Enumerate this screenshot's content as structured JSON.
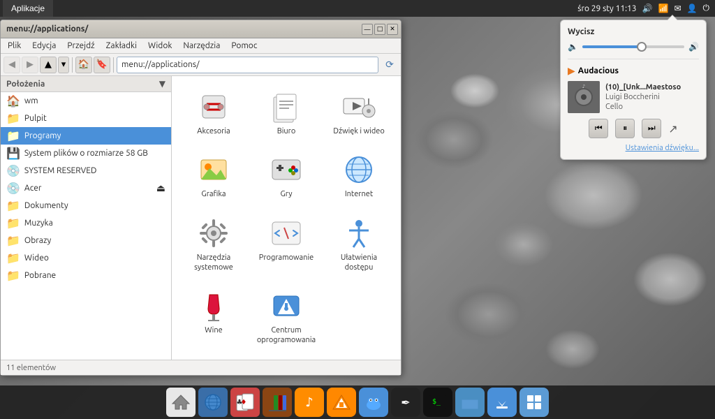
{
  "desktop": {
    "background_description": "rocky stones"
  },
  "top_panel": {
    "apps_button": "Aplikacje",
    "datetime": "śro 29 sty 11:13",
    "icons": [
      "volume",
      "wifi",
      "email",
      "user",
      "power"
    ]
  },
  "file_manager": {
    "title": "menu://applications/",
    "window_buttons": {
      "minimize": "—",
      "maximize": "□",
      "close": "✕"
    },
    "menubar": [
      {
        "label": "Plik"
      },
      {
        "label": "Edycja"
      },
      {
        "label": "Przejdź"
      },
      {
        "label": "Zakładki"
      },
      {
        "label": "Widok"
      },
      {
        "label": "Narzędzia"
      },
      {
        "label": "Pomoc"
      }
    ],
    "toolbar": {
      "back_disabled": true,
      "forward_disabled": true,
      "up_enabled": true,
      "down_arrow": true,
      "home_enabled": true,
      "bookmark_enabled": true,
      "address": "menu://applications/",
      "reload_label": "⟳"
    },
    "sidebar": {
      "header": "Położenia",
      "items": [
        {
          "label": "wm",
          "icon": "🏠",
          "type": "home"
        },
        {
          "label": "Pulpit",
          "icon": "📁",
          "type": "folder"
        },
        {
          "label": "Programy",
          "icon": "📁",
          "type": "folder",
          "active": true
        },
        {
          "label": "System plików o rozmiarze 58 GB",
          "icon": "💾",
          "type": "drive"
        },
        {
          "label": "SYSTEM RESERVED",
          "icon": "💿",
          "type": "drive"
        },
        {
          "label": "Acer",
          "icon": "💿",
          "type": "drive-eject"
        },
        {
          "label": "Dokumenty",
          "icon": "📁",
          "type": "folder"
        },
        {
          "label": "Muzyka",
          "icon": "📁",
          "type": "folder"
        },
        {
          "label": "Obrazy",
          "icon": "📁",
          "type": "folder"
        },
        {
          "label": "Wideo",
          "icon": "📁",
          "type": "folder"
        },
        {
          "label": "Pobrane",
          "icon": "📁",
          "type": "folder"
        }
      ]
    },
    "files": [
      {
        "label": "Akcesoria",
        "icon": "scissors"
      },
      {
        "label": "Biuro",
        "icon": "office"
      },
      {
        "label": "Dźwięk i wideo",
        "icon": "media"
      },
      {
        "label": "Grafika",
        "icon": "paint"
      },
      {
        "label": "Gry",
        "icon": "games"
      },
      {
        "label": "Internet",
        "icon": "internet"
      },
      {
        "label": "Narzędzia systemowe",
        "icon": "settings"
      },
      {
        "label": "Programowanie",
        "icon": "programming"
      },
      {
        "label": "Ułatwienia dostępu",
        "icon": "accessibility"
      },
      {
        "label": "Wine",
        "icon": "wine"
      },
      {
        "label": "Centrum oprogramowania",
        "icon": "software-center"
      }
    ],
    "statusbar": "11 elementów"
  },
  "sound_widget": {
    "title": "Wycisz",
    "volume_min_icon": "🔈",
    "volume_max_icon": "🔊",
    "volume_level": 60,
    "player_name": "Audacious",
    "track_title": "(10)_[Unk...Maestoso",
    "track_artist": "Luigi Boccherini",
    "track_album": "Cello",
    "controls": {
      "prev": "⏮",
      "pause": "⏸",
      "next": "⏭"
    },
    "settings_link": "Ustawienia dźwięku..."
  },
  "taskbar": {
    "icons": [
      {
        "name": "home",
        "label": "🏠",
        "bg": "#e8e8e8"
      },
      {
        "name": "globe",
        "label": "🌐",
        "bg": "#3a6ea8"
      },
      {
        "name": "cards",
        "label": "🃏",
        "bg": "#ddd"
      },
      {
        "name": "books",
        "label": "📚",
        "bg": "#a0522d"
      },
      {
        "name": "music-note",
        "label": "♪",
        "bg": "#ff8c00"
      },
      {
        "name": "vlc",
        "label": "🔶",
        "bg": "#ff8800"
      },
      {
        "name": "fish",
        "label": "🐟",
        "bg": "#4a90d9"
      },
      {
        "name": "inkscape",
        "label": "✒",
        "bg": "#222"
      },
      {
        "name": "terminal",
        "label": "$",
        "bg": "#222"
      },
      {
        "name": "folder-blue",
        "label": "📁",
        "bg": "#5b9bd5"
      },
      {
        "name": "download-arrow",
        "label": "⬇",
        "bg": "#4a90d9"
      },
      {
        "name": "grid-view",
        "label": "⊞",
        "bg": "#5b9bd5"
      }
    ]
  }
}
